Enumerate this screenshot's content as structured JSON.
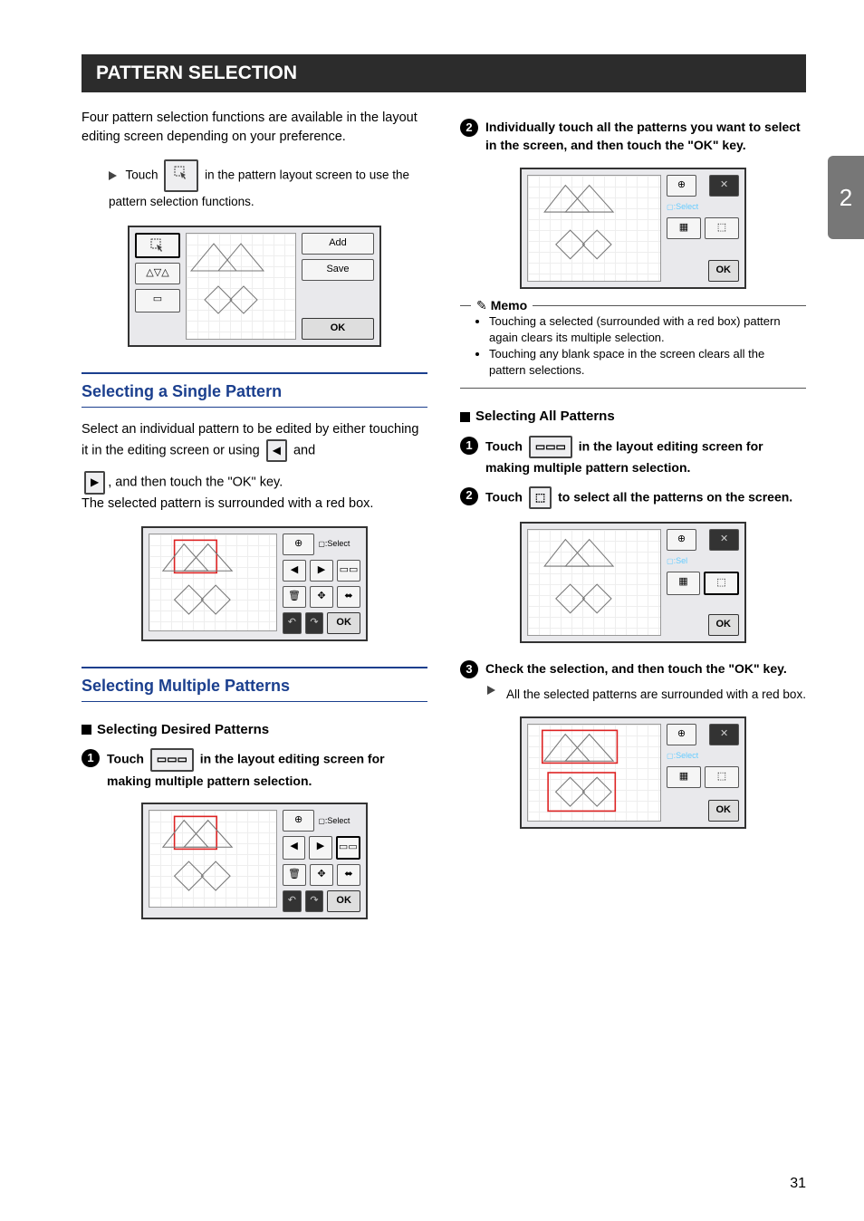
{
  "chapter_tab": "2",
  "page_number": "31",
  "section_title": "PATTERN SELECTION",
  "left": {
    "intro": "Four pattern selection functions are available in the layout editing screen depending on your preference.",
    "step_touch_a": "Touch",
    "step_touch_b": "in the pattern layout screen to use the pattern selection functions.",
    "fig1": {
      "add": "Add",
      "save": "Save",
      "ok": "OK"
    },
    "h2_single": "Selecting a Single Pattern",
    "single_p1": "Select an individual pattern to be edited by either touching it in the editing screen or using",
    "single_p2": "and",
    "single_p3": ", and then touch the \"OK\" key.",
    "single_p4": "The selected pattern is surrounded with a red box.",
    "fig2": {
      "select_label": ":Select",
      "ok": "OK"
    },
    "h2_multi": "Selecting Multiple Patterns",
    "h3_desired": "Selecting Desired Patterns",
    "step1_a": "Touch",
    "step1_b": "in the layout editing screen for making multiple pattern selection.",
    "fig3": {
      "select_label": ":Select",
      "ok": "OK"
    }
  },
  "right": {
    "step2": "Individually touch all the patterns you want to select in the screen, and then touch the \"OK\" key.",
    "fig4": {
      "select_label": ":Select",
      "ok": "OK"
    },
    "memo_title": "Memo",
    "memo_items": [
      "Touching a selected (surrounded with a red box) pattern again clears its multiple selection.",
      "Touching any blank space in the screen clears all the pattern selections."
    ],
    "h3_all": "Selecting All Patterns",
    "all_step1_a": "Touch",
    "all_step1_b": "in the layout editing screen for making multiple pattern selection.",
    "all_step2_a": "Touch",
    "all_step2_b": "to select all the patterns on the screen.",
    "fig5": {
      "select_label": ":Sel",
      "ok": "OK"
    },
    "all_step3": "Check the selection, and then touch the \"OK\" key.",
    "all_note": "All the selected patterns are surrounded with a red box.",
    "fig6": {
      "select_label": ":Select",
      "ok": "OK"
    }
  },
  "icons": {
    "selection_tool": "⬚",
    "arrow_left": "◀",
    "arrow_right": "▶",
    "multi_select": "▭▭▭",
    "select_all": "⬚✓",
    "close_x": "✕",
    "zoom_plus": "⊕"
  }
}
